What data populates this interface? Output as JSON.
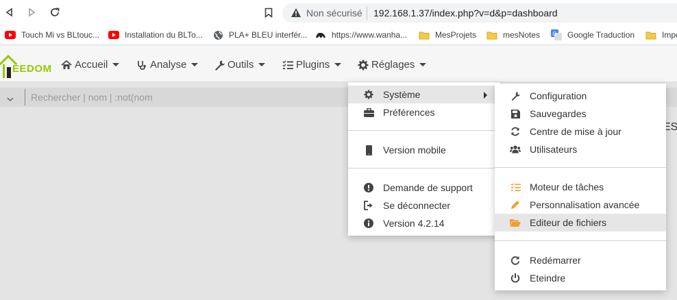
{
  "browser": {
    "address": {
      "security_label": "Non sécurisé",
      "url": "192.168.1.37/index.php?v=d&p=dashboard"
    },
    "bookmarks": [
      {
        "label": "Touch Mi vs BLtouc...",
        "icon": "youtube-icon"
      },
      {
        "label": "Installation du BLTo...",
        "icon": "youtube-icon"
      },
      {
        "label": "PLA+ BLEU interfér...",
        "icon": "globe-icon"
      },
      {
        "label": "https://www.wanha...",
        "icon": "site-icon"
      },
      {
        "label": "MesProjets",
        "icon": "folder-icon"
      },
      {
        "label": "mesNotes",
        "icon": "folder-icon"
      },
      {
        "label": "Google Traduction",
        "icon": "translate-icon"
      },
      {
        "label": "Impo",
        "icon": "folder-icon"
      }
    ]
  },
  "app": {
    "logo_text": "EEDOM",
    "menu": [
      {
        "label": "Accueil",
        "icon": "home-icon"
      },
      {
        "label": "Analyse",
        "icon": "stethoscope-icon"
      },
      {
        "label": "Outils",
        "icon": "wrench-icon"
      },
      {
        "label": "Plugins",
        "icon": "tasks-icon"
      },
      {
        "label": "Réglages",
        "icon": "cog-icon"
      }
    ],
    "search": {
      "placeholder": "Rechercher | nom | :not(nom"
    },
    "partial_text": "ES"
  },
  "reglages_menu": {
    "items": [
      {
        "label": "Système",
        "icon": "cog-icon"
      },
      {
        "label": "Préférences",
        "icon": "briefcase-icon"
      },
      {
        "label": "Version mobile",
        "icon": "mobile-icon"
      },
      {
        "label": "Demande de support",
        "icon": "exclamation-circle-icon"
      },
      {
        "label": "Se déconnecter",
        "icon": "sign-out-icon"
      },
      {
        "label": "Version 4.2.14",
        "icon": "info-circle-icon"
      }
    ]
  },
  "systeme_submenu": {
    "items": [
      {
        "label": "Configuration",
        "icon": "wrench-icon"
      },
      {
        "label": "Sauvegardes",
        "icon": "save-icon"
      },
      {
        "label": "Centre de mise à jour",
        "icon": "refresh-icon"
      },
      {
        "label": "Utilisateurs",
        "icon": "users-icon"
      },
      {
        "label": "Moteur de tâches",
        "icon": "tasks-icon"
      },
      {
        "label": "Personnalisation avancée",
        "icon": "pencil-icon"
      },
      {
        "label": "Editeur de fichiers",
        "icon": "folder-open-icon"
      },
      {
        "label": "Redémarrer",
        "icon": "redo-icon"
      },
      {
        "label": "Eteindre",
        "icon": "power-icon"
      }
    ]
  },
  "colors": {
    "accent_orange": "#f0a030",
    "logo_green": "#94ca02",
    "hover_gray": "#e6e6e6"
  }
}
